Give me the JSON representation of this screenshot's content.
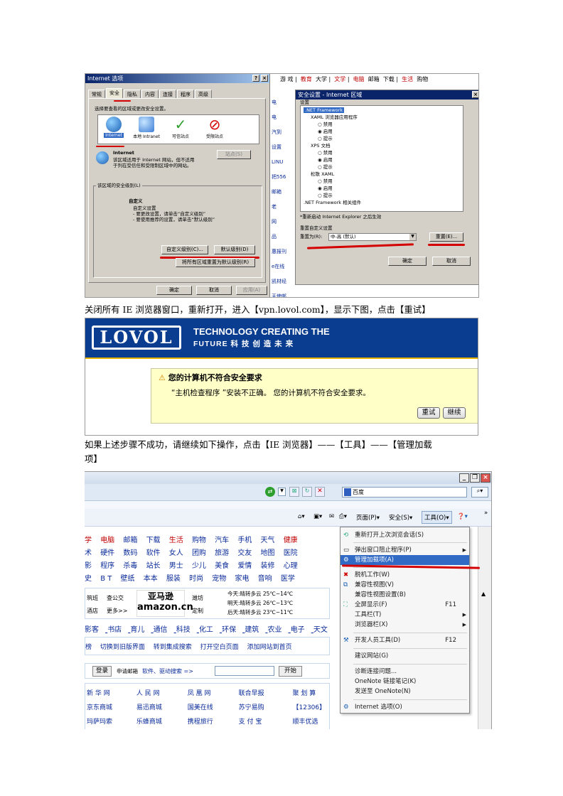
{
  "shot1": {
    "internet_options": {
      "title": "Internet 选项",
      "tabs": [
        "常规",
        "安全",
        "隐私",
        "内容",
        "连接",
        "程序",
        "高级"
      ],
      "select_zone_text": "选择要查看的区域或更改安全设置。",
      "zones": [
        "Internet",
        "本地 Intranet",
        "可信站点",
        "受限站点"
      ],
      "zone_name": "Internet",
      "zone_desc": "该区域适用于 Internet 网站，但不适用于列在受信任和受限制区域中的网站。",
      "sites_button": "站点(S)",
      "level_group": "该区域的安全级别(L)",
      "level_name": "自定义",
      "level_lines": [
        "自定义设置",
        "- 要更改设置，请单击“自定义级别”",
        "- 要使用推荐的设置，请单击“默认级别”"
      ],
      "custom_level_button": "自定义级别(C)...",
      "default_level_button": "默认级别(D)",
      "reset_all_button": "将所有区域重置为默认级别(R)",
      "ok": "确定",
      "cancel": "取消",
      "apply": "应用(A)"
    },
    "security_settings": {
      "title": "安全设置 - Internet 区域",
      "settings_label": "设置",
      "tree": [
        ".NET Framework",
        "XAML 浏览器应用程序",
        "禁用",
        "启用",
        "提示",
        "XPS 文档",
        "禁用",
        "启用",
        "提示",
        "松散 XAML",
        "禁用",
        "启用",
        "提示",
        ".NET Framework 相关组件"
      ],
      "restart_note": "*重新启动 Internet Explorer 之后生效",
      "reset_group": "重置自定义设置",
      "reset_to_label": "重置为(R):",
      "reset_to_value": "中-高 (默认)",
      "reset_button": "重置(E)...",
      "ok": "确定",
      "cancel": "取消"
    },
    "bg_links_top": [
      "游 戏",
      "教育",
      "大学",
      "文学",
      "电脑",
      "邮箱",
      "下载",
      "生活",
      "购物"
    ],
    "bg_left": [
      "电",
      "电",
      "汽到",
      "设置",
      "LINU",
      "把556",
      "邮箱",
      "老",
      "网",
      "品",
      "惠报刊",
      "e在线",
      "凯材经",
      "天使邮"
    ]
  },
  "caption1": "关闭所有 IE 浏览器窗口，重新打开，进入【vpn.lovol.com】，显示下图，点击【重试】",
  "shot2": {
    "logo": "LOVOL",
    "slogan_line1": "TECHNOLOGY CREATING THE",
    "slogan_line2": "FUTURE 科 技 创 造 未 来",
    "warning_title": "您的计算机不符合安全要求",
    "warning_message": "“主机检查程序 ”安装不正确。 您的计算机不符合安全要求。",
    "retry_button": "重试",
    "continue_button": "继续"
  },
  "caption2_line1": "如果上述步骤不成功，请继续如下操作，点击【IE 浏览器】——【工具】——【管理加载",
  "caption2_line2": "项】",
  "shot3": {
    "search_placeholder": "百度",
    "commands": [
      "页面(P)",
      "安全(S)",
      "工具(O)"
    ],
    "portal_rows": [
      [
        "学",
        "电脑",
        "邮箱",
        "下载",
        "生活",
        "购物",
        "汽车",
        "手机",
        "天气",
        "健康"
      ],
      [
        "术",
        "硬件",
        "数码",
        "软件",
        "女人",
        "团购",
        "旅游",
        "交友",
        "地图",
        "医院"
      ],
      [
        "影",
        "程序",
        "杀毒",
        "站长",
        "男士",
        "少儿",
        "美食",
        "爱情",
        "装修",
        "心理"
      ],
      [
        "史",
        "B T",
        "壁纸",
        "本本",
        "服装",
        "时尚",
        "宠物",
        "家电",
        "音响",
        "医学"
      ]
    ],
    "amazon_left": [
      "筑班",
      "查公交",
      "酒店",
      "更多>>"
    ],
    "amazon_logo_text": "亚马逊",
    "amazon_logo_sub": "amazon.cn",
    "weather_city": "潍坊",
    "weather_custom": "定制",
    "weather": [
      "今天:晴转多云 25℃~14℃",
      "明天:晴转多云 26℃~13℃",
      "后天:晴转多云 23℃~11℃"
    ],
    "category_row": [
      "影客",
      "书店",
      "育儿",
      "通信",
      "科技",
      "化工",
      "环保",
      "建筑",
      "农业",
      "电子",
      "天文"
    ],
    "switch_row": [
      "榜",
      "切换到旧版界面",
      "转到集成搜索",
      "打开空白页面",
      "添加网站到首页"
    ],
    "login_button": "登录",
    "mail_label": "申请邮箱",
    "search_hint": "软件、驱动搜索 =>",
    "start_button": "开始",
    "sites": [
      [
        "新 华 网",
        "人 民 网",
        "凤 凰 网",
        "联合早报",
        "聚 划 算"
      ],
      [
        "京东商城",
        "易迅商城",
        "国美在线",
        "苏宁易购",
        "【12306】"
      ],
      [
        "玛萨玛索",
        "乐蜂商城",
        "携程旅行",
        "支 付 宝",
        "顺丰优选"
      ]
    ],
    "tools_menu": [
      {
        "label": "重新打开上次浏览会话(S)",
        "shortcut": ""
      },
      {
        "label": "弹出窗口阻止程序(P)",
        "shortcut": "",
        "arrow": true
      },
      {
        "label": "管理加载项(A)",
        "shortcut": "",
        "highlight": true
      },
      {
        "label": "脱机工作(W)",
        "shortcut": ""
      },
      {
        "label": "兼容性视图(V)",
        "shortcut": ""
      },
      {
        "label": "兼容性视图设置(B)",
        "shortcut": ""
      },
      {
        "label": "全屏显示(F)",
        "shortcut": "F11"
      },
      {
        "label": "工具栏(T)",
        "shortcut": "",
        "arrow": true
      },
      {
        "label": "浏览器栏(X)",
        "shortcut": "",
        "arrow": true
      },
      {
        "label": "开发人员工具(D)",
        "shortcut": "F12"
      },
      {
        "label": "建议网站(G)",
        "shortcut": ""
      },
      {
        "label": "诊断连接问题...",
        "shortcut": ""
      },
      {
        "label": "OneNote 链接笔记(K)",
        "shortcut": ""
      },
      {
        "label": "发送至 OneNote(N)",
        "shortcut": ""
      },
      {
        "label": "Internet 选项(O)",
        "shortcut": ""
      }
    ]
  }
}
